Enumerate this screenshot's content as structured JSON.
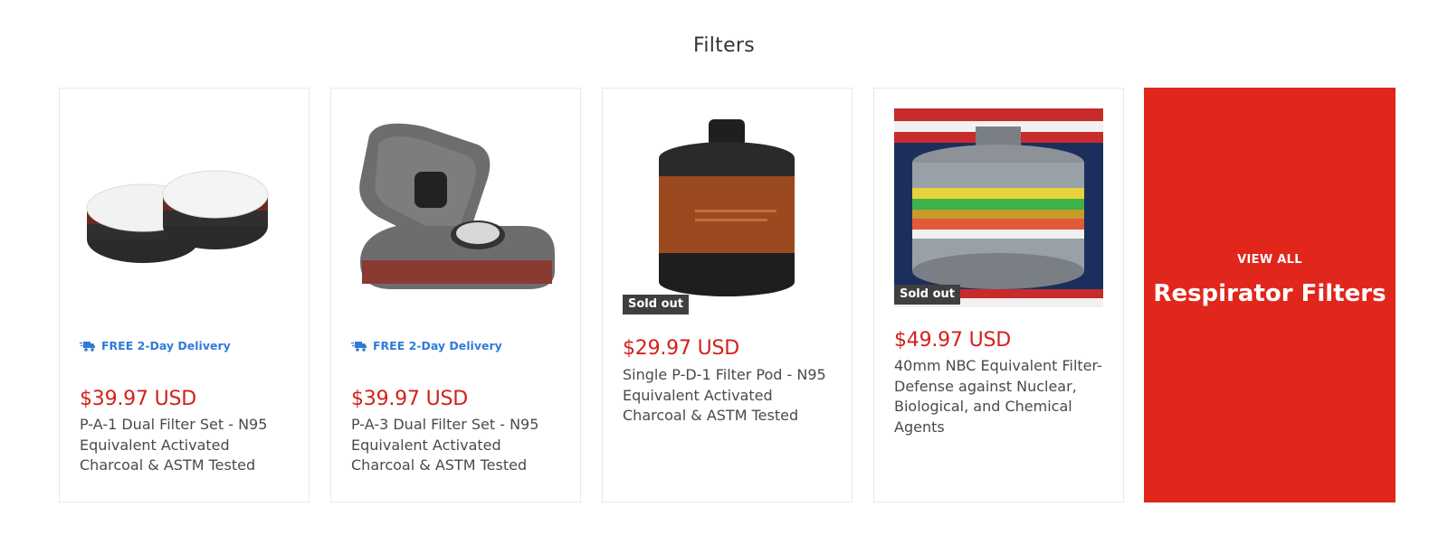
{
  "section": {
    "title": "Filters"
  },
  "products": [
    {
      "delivery": "FREE 2-Day Delivery",
      "price": "$39.97 USD",
      "title": "P-A-1 Dual Filter Set - N95 Equivalent Activated Charcoal & ASTM Tested"
    },
    {
      "delivery": "FREE 2-Day Delivery",
      "price": "$39.97 USD",
      "title": "P-A-3 Dual Filter Set - N95 Equivalent Activated Charcoal & ASTM Tested"
    },
    {
      "badge": "Sold out",
      "price": "$29.97 USD",
      "title": "Single P-D-1 Filter Pod - N95 Equivalent Activated Charcoal & ASTM Tested"
    },
    {
      "badge": "Sold out",
      "price": "$49.97 USD",
      "title": "40mm NBC Equivalent Filter- Defense against Nuclear, Biological, and Chemical Agents"
    }
  ],
  "promo": {
    "kicker": "VIEW ALL",
    "title": "Respirator Filters"
  },
  "colors": {
    "price": "#d4201c",
    "delivery": "#2f7cd8",
    "promo_bg": "#e1261c",
    "badge_bg": "#3f3f3f"
  },
  "icons": {
    "delivery": "delivery-truck-icon"
  }
}
